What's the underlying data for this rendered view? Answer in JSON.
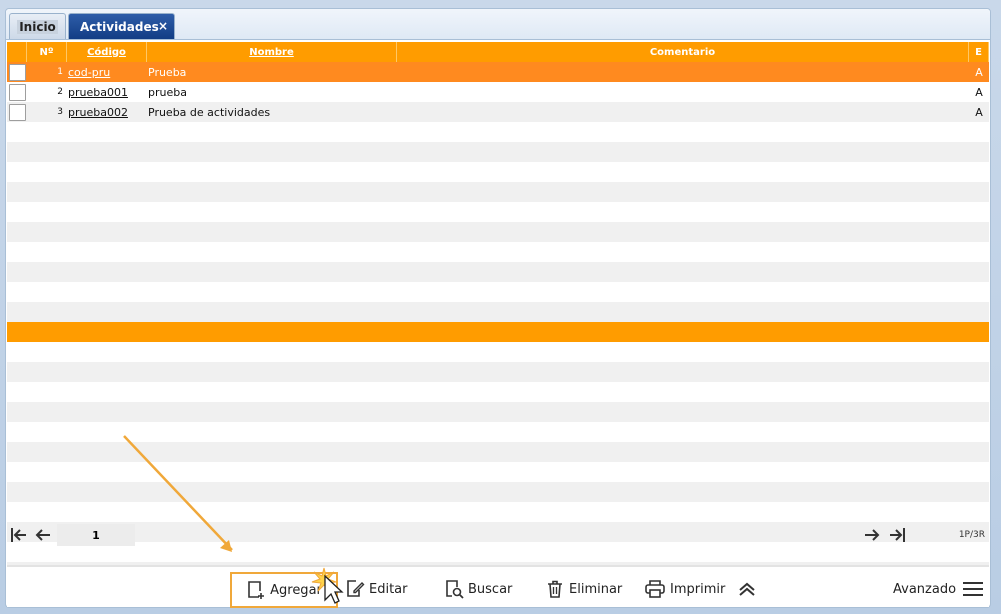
{
  "tabs": [
    {
      "label": "Inicio"
    },
    {
      "label": "Actividades",
      "close": "×"
    }
  ],
  "grid": {
    "columns": [
      "Nº",
      "Código",
      "Nombre",
      "Comentario",
      "E"
    ],
    "rows": [
      {
        "n": "1",
        "codigo": "cod-pru",
        "nombre": "Prueba",
        "comentario": "",
        "e": "A"
      },
      {
        "n": "2",
        "codigo": "prueba001",
        "nombre": "prueba",
        "comentario": "",
        "e": "A"
      },
      {
        "n": "3",
        "codigo": "prueba002",
        "nombre": "Prueba de actividades",
        "comentario": "",
        "e": "A"
      }
    ]
  },
  "pager": {
    "page": "1",
    "count": "1P/3R"
  },
  "toolbar": {
    "agregar": "Agregar",
    "editar": "Editar",
    "buscar": "Buscar",
    "eliminar": "Eliminar",
    "imprimir": "Imprimir",
    "avanzado": "Avanzado"
  },
  "colors": {
    "header": "#ff9c00",
    "selected_row": "#ff8a1f",
    "active_tab": "#1b4690",
    "highlight": "#f0a83a"
  }
}
